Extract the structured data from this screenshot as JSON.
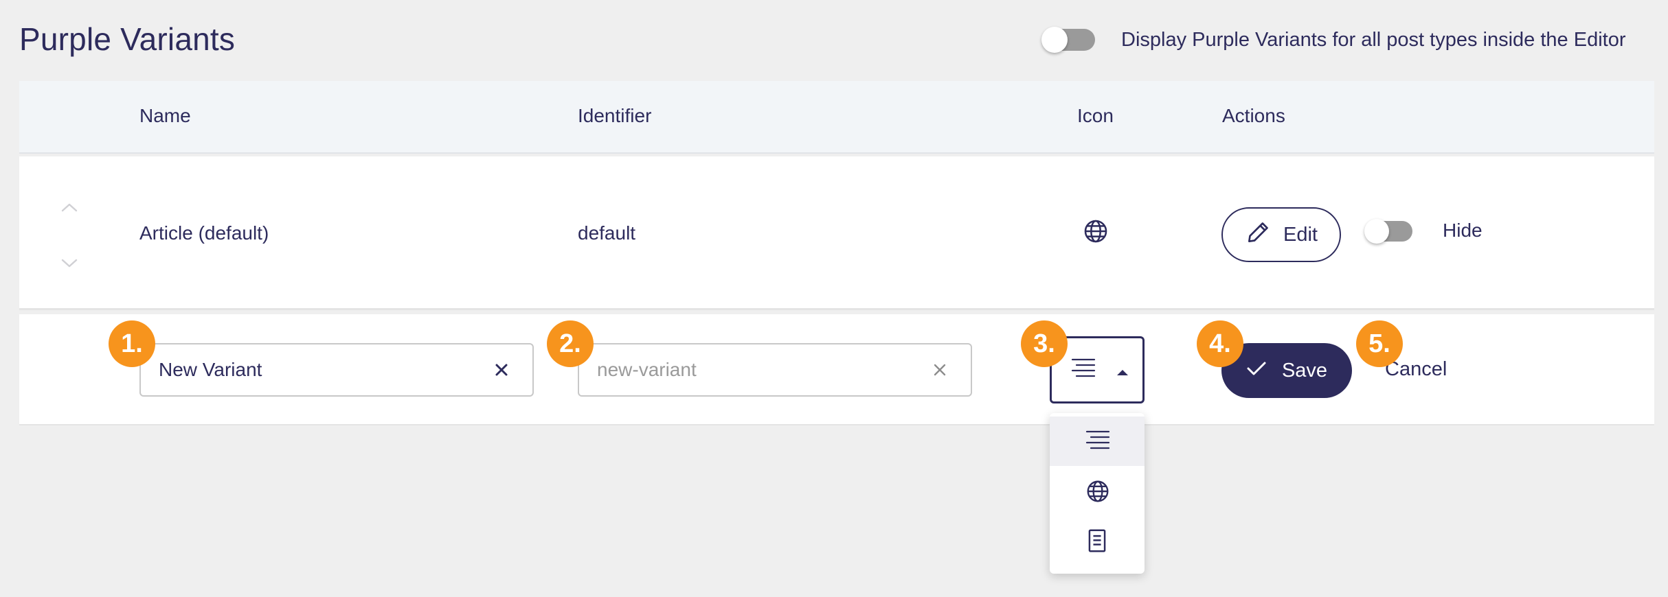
{
  "page": {
    "title": "Purple Variants",
    "global_toggle_label": "Display Purple Variants for all post types inside the Editor",
    "global_toggle_on": false
  },
  "table": {
    "columns": [
      "Name",
      "Identifier",
      "Icon",
      "Actions"
    ]
  },
  "rows": [
    {
      "name": "Article (default)",
      "identifier": "default",
      "icon": "globe-icon",
      "edit_label": "Edit",
      "hide_label": "Hide",
      "hidden": false
    }
  ],
  "new_row": {
    "name_value": "New Variant",
    "identifier_value": "",
    "identifier_placeholder": "new-variant",
    "selected_icon": "text-lines-icon",
    "save_label": "Save",
    "cancel_label": "Cancel"
  },
  "icon_menu": {
    "options": [
      "text-lines-icon",
      "globe-icon",
      "document-icon"
    ],
    "selected_index": 0
  },
  "badges": [
    "1.",
    "2.",
    "3.",
    "4.",
    "5."
  ],
  "colors": {
    "primary": "#2d2b5c",
    "badge": "#f7941d",
    "header_bg": "#f2f5f8",
    "page_bg": "#efefef",
    "toggle_off": "#9a9a9a"
  }
}
